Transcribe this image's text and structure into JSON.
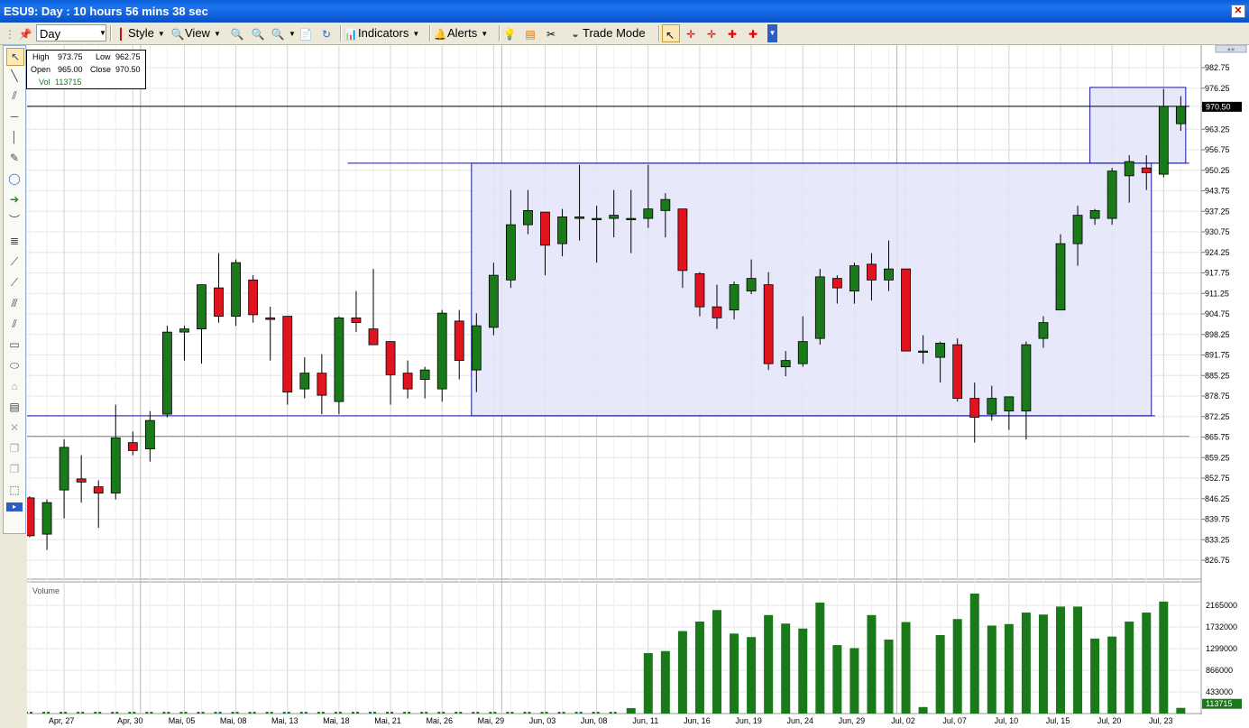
{
  "window": {
    "title": "ESU9: Day : 10 hours 56 mins 38 sec",
    "close_label": "✕"
  },
  "toolbar": {
    "period": "Day",
    "style_label": "Style",
    "view_label": "View",
    "indicators_label": "Indicators",
    "alerts_label": "Alerts",
    "trade_mode_label": "Trade Mode"
  },
  "info": {
    "high_label": "High",
    "high": "973.75",
    "low_label": "Low",
    "low": "962.75",
    "open_label": "Open",
    "open": "965.00",
    "close_label": "Close",
    "close": "970.50",
    "vol_label": "Vol",
    "vol": "113715"
  },
  "volume_panel_label": "Volume",
  "colors": {
    "up": "#1a7a1a",
    "down": "#e0141e",
    "volume": "#1a7a1a",
    "rect_fill": "#e4e4fa",
    "rect_stroke": "#1a1a99"
  },
  "chart_data": {
    "type": "candlestick",
    "price_axis": {
      "ylim": [
        822,
        988
      ],
      "ticks": [
        "982.75",
        "976.25",
        "970.50",
        "963.25",
        "956.75",
        "950.25",
        "943.75",
        "937.25",
        "930.75",
        "924.25",
        "917.75",
        "911.25",
        "904.75",
        "898.25",
        "891.75",
        "885.25",
        "878.75",
        "872.25",
        "865.75",
        "859.25",
        "852.75",
        "846.25",
        "839.75",
        "833.25",
        "826.75"
      ],
      "last_price": "970.50"
    },
    "volume_axis": {
      "ylim": [
        0,
        2500000
      ],
      "ticks": [
        "2165000",
        "1732000",
        "1299000",
        "866000",
        "433000"
      ],
      "last_volume": "113715"
    },
    "x_labels": [
      {
        "i": 2,
        "label": "Apr, 27"
      },
      {
        "i": 6,
        "label": "Apr, 30"
      },
      {
        "i": 9,
        "label": "Mai, 05"
      },
      {
        "i": 12,
        "label": "Mai, 08"
      },
      {
        "i": 15,
        "label": "Mai, 13"
      },
      {
        "i": 18,
        "label": "Mai, 18"
      },
      {
        "i": 21,
        "label": "Mai, 21"
      },
      {
        "i": 24,
        "label": "Mai, 26"
      },
      {
        "i": 27,
        "label": "Mai, 29"
      },
      {
        "i": 30,
        "label": "Jun, 03"
      },
      {
        "i": 33,
        "label": "Jun, 08"
      },
      {
        "i": 36,
        "label": "Jun, 11"
      },
      {
        "i": 39,
        "label": "Jun, 16"
      },
      {
        "i": 42,
        "label": "Jun, 19"
      },
      {
        "i": 45,
        "label": "Jun, 24"
      },
      {
        "i": 48,
        "label": "Jun, 29"
      },
      {
        "i": 51,
        "label": "Jul, 02"
      },
      {
        "i": 54,
        "label": "Jul, 07"
      },
      {
        "i": 57,
        "label": "Jul, 10"
      },
      {
        "i": 60,
        "label": "Jul, 15"
      },
      {
        "i": 63,
        "label": "Jul, 20"
      },
      {
        "i": 66,
        "label": "Jul, 23"
      }
    ],
    "candles": [
      {
        "o": 846.5,
        "h": 847,
        "l": 834,
        "c": 834.5,
        "v": 20000
      },
      {
        "o": 835,
        "h": 846,
        "l": 830,
        "c": 845,
        "v": 20000
      },
      {
        "o": 849,
        "h": 865,
        "l": 840,
        "c": 862.5,
        "v": 20000
      },
      {
        "o": 852.5,
        "h": 860,
        "l": 845,
        "c": 851.5,
        "v": 20000
      },
      {
        "o": 850,
        "h": 852,
        "l": 837,
        "c": 848,
        "v": 20000
      },
      {
        "o": 848,
        "h": 876,
        "l": 846,
        "c": 865.5,
        "v": 20000
      },
      {
        "o": 864,
        "h": 867.5,
        "l": 860,
        "c": 861.5,
        "v": 20000
      },
      {
        "o": 862,
        "h": 874,
        "l": 858,
        "c": 871,
        "v": 20000
      },
      {
        "o": 873,
        "h": 901,
        "l": 872,
        "c": 899,
        "v": 20000
      },
      {
        "o": 899,
        "h": 901,
        "l": 890,
        "c": 900,
        "v": 20000
      },
      {
        "o": 900,
        "h": 914,
        "l": 889,
        "c": 914,
        "v": 20000
      },
      {
        "o": 913,
        "h": 924,
        "l": 902,
        "c": 904,
        "v": 20000
      },
      {
        "o": 904,
        "h": 922,
        "l": 901,
        "c": 921,
        "v": 20000
      },
      {
        "o": 915.5,
        "h": 917,
        "l": 902,
        "c": 904.5,
        "v": 20000
      },
      {
        "o": 903.5,
        "h": 907,
        "l": 890,
        "c": 903,
        "v": 20000
      },
      {
        "o": 904,
        "h": 904,
        "l": 876,
        "c": 880,
        "v": 20000
      },
      {
        "o": 881,
        "h": 891,
        "l": 878,
        "c": 886,
        "v": 20000
      },
      {
        "o": 886,
        "h": 892,
        "l": 873,
        "c": 879,
        "v": 20000
      },
      {
        "o": 877,
        "h": 904,
        "l": 873,
        "c": 903.5,
        "v": 20000
      },
      {
        "o": 903.5,
        "h": 912,
        "l": 899,
        "c": 902,
        "v": 20000
      },
      {
        "o": 900,
        "h": 919,
        "l": 895,
        "c": 895,
        "v": 20000
      },
      {
        "o": 896,
        "h": 896,
        "l": 876,
        "c": 885.5,
        "v": 20000
      },
      {
        "o": 886,
        "h": 890,
        "l": 878,
        "c": 881,
        "v": 20000
      },
      {
        "o": 884,
        "h": 888,
        "l": 878,
        "c": 887,
        "v": 20000
      },
      {
        "o": 881,
        "h": 906,
        "l": 877,
        "c": 905,
        "v": 20000
      },
      {
        "o": 902.5,
        "h": 906,
        "l": 884,
        "c": 890,
        "v": 20000
      },
      {
        "o": 887,
        "h": 905,
        "l": 880,
        "c": 901,
        "v": 20000
      },
      {
        "o": 900.5,
        "h": 921,
        "l": 898,
        "c": 917,
        "v": 20000
      },
      {
        "o": 915.5,
        "h": 944,
        "l": 913,
        "c": 933,
        "v": 20000
      },
      {
        "o": 933,
        "h": 944,
        "l": 930,
        "c": 937.5,
        "v": 20000
      },
      {
        "o": 937,
        "h": 937,
        "l": 917,
        "c": 926.5,
        "v": 20000
      },
      {
        "o": 927,
        "h": 938,
        "l": 923,
        "c": 935.5,
        "v": 20000
      },
      {
        "o": 935,
        "h": 952,
        "l": 928,
        "c": 935.5,
        "v": 20000
      },
      {
        "o": 935,
        "h": 939,
        "l": 921,
        "c": 935,
        "v": 20000
      },
      {
        "o": 935,
        "h": 944,
        "l": 929,
        "c": 936,
        "v": 20000
      },
      {
        "o": 935,
        "h": 944,
        "l": 924,
        "c": 935,
        "v": 110000
      },
      {
        "o": 935,
        "h": 952,
        "l": 932,
        "c": 938,
        "v": 1210000
      },
      {
        "o": 937.5,
        "h": 943,
        "l": 929,
        "c": 941,
        "v": 1250000
      },
      {
        "o": 938,
        "h": 938,
        "l": 913,
        "c": 918.5,
        "v": 1650000
      },
      {
        "o": 917.5,
        "h": 918,
        "l": 904,
        "c": 907,
        "v": 1840000
      },
      {
        "o": 907,
        "h": 914,
        "l": 900,
        "c": 903.5,
        "v": 2070000
      },
      {
        "o": 906,
        "h": 915,
        "l": 903,
        "c": 914,
        "v": 1600000
      },
      {
        "o": 912,
        "h": 922,
        "l": 911,
        "c": 916,
        "v": 1530000
      },
      {
        "o": 914,
        "h": 918,
        "l": 887,
        "c": 889,
        "v": 1970000
      },
      {
        "o": 888,
        "h": 893,
        "l": 885,
        "c": 890,
        "v": 1800000
      },
      {
        "o": 889,
        "h": 904,
        "l": 888,
        "c": 896,
        "v": 1700000
      },
      {
        "o": 897,
        "h": 919,
        "l": 895,
        "c": 916.5,
        "v": 2220000
      },
      {
        "o": 916,
        "h": 917,
        "l": 908,
        "c": 913,
        "v": 1370000
      },
      {
        "o": 912,
        "h": 921,
        "l": 908,
        "c": 920,
        "v": 1310000
      },
      {
        "o": 920.5,
        "h": 924,
        "l": 909,
        "c": 915.5,
        "v": 1970000
      },
      {
        "o": 915.5,
        "h": 928,
        "l": 912,
        "c": 919,
        "v": 1480000
      },
      {
        "o": 919,
        "h": 919,
        "l": 893,
        "c": 893,
        "v": 1830000
      },
      {
        "o": 893,
        "h": 898,
        "l": 889,
        "c": 893,
        "v": 130000
      },
      {
        "o": 891,
        "h": 896,
        "l": 883,
        "c": 895.5,
        "v": 1570000
      },
      {
        "o": 895,
        "h": 897,
        "l": 877,
        "c": 878,
        "v": 1890000
      },
      {
        "o": 878,
        "h": 883,
        "l": 864,
        "c": 872,
        "v": 2400000
      },
      {
        "o": 873,
        "h": 882,
        "l": 871,
        "c": 878,
        "v": 1760000
      },
      {
        "o": 874,
        "h": 878,
        "l": 868,
        "c": 878.5,
        "v": 1790000
      },
      {
        "o": 874,
        "h": 896,
        "l": 865,
        "c": 895,
        "v": 2020000
      },
      {
        "o": 897,
        "h": 904,
        "l": 894,
        "c": 902,
        "v": 1980000
      },
      {
        "o": 906,
        "h": 930,
        "l": 906,
        "c": 927,
        "v": 2140000
      },
      {
        "o": 927,
        "h": 939,
        "l": 920,
        "c": 936,
        "v": 2140000
      },
      {
        "o": 935,
        "h": 938,
        "l": 933,
        "c": 937.5,
        "v": 1500000
      },
      {
        "o": 935,
        "h": 951,
        "l": 933,
        "c": 950,
        "v": 1540000
      },
      {
        "o": 948.5,
        "h": 955,
        "l": 940,
        "c": 953,
        "v": 1840000
      },
      {
        "o": 951,
        "h": 955,
        "l": 944,
        "c": 949.5,
        "v": 2020000
      },
      {
        "o": 949,
        "h": 976,
        "l": 948,
        "c": 970.5,
        "v": 2240000
      },
      {
        "o": 965,
        "h": 973.75,
        "l": 962.75,
        "c": 970.5,
        "v": 113715
      }
    ],
    "annotations": [
      {
        "type": "rectangle",
        "from": {
          "i": 26,
          "price": 952.5
        },
        "to": {
          "i": 65,
          "price": 872.5
        }
      },
      {
        "type": "rectangle",
        "from": {
          "i": 62,
          "price": 976.5
        },
        "to": {
          "i": 67,
          "price": 952.5
        }
      },
      {
        "type": "hline",
        "price": 952.5,
        "from_i": 19,
        "to_i": 67
      },
      {
        "type": "hline",
        "price": 872.5,
        "from_i": 0,
        "to_i": 65
      },
      {
        "type": "hline",
        "price": 970.5,
        "from_i": 0,
        "to_i": 67
      },
      {
        "type": "hline",
        "price": 866,
        "from_i": 0,
        "to_i": 67
      }
    ]
  }
}
